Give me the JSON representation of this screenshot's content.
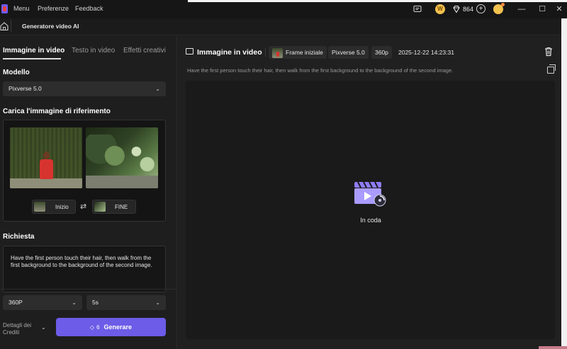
{
  "titlebar": {
    "menu": [
      "Menu",
      "Preferenze",
      "Feedback"
    ],
    "credits": "864",
    "coin_symbol": "W",
    "window_controls": {
      "minimize": "—",
      "maximize": "☐",
      "close": "✕"
    }
  },
  "tab": {
    "title": "Generatore video AI"
  },
  "left": {
    "mode_tabs": [
      "Immagine in video",
      "Testo in video",
      "Effetti creativi"
    ],
    "model_label": "Modello",
    "model_value": "Pixverse 5.0",
    "upload_label": "Carica l'immagine di riferimento",
    "start_label": "Inizio",
    "end_label": "FINE",
    "prompt_label": "Richiesta",
    "prompt_text": "Have the first person touch their hair, then walk from the first background to the background of the second image.",
    "resolution_value": "360P",
    "duration_value": "5s",
    "credits_details": "Dettagli dei Crediti",
    "generate_cost": "6",
    "generate_label": "Generare"
  },
  "right": {
    "title": "Immagine in video",
    "chip_frame": "Frame iniziale",
    "chip_model": "Pixverse 5.0",
    "chip_res": "360p",
    "datetime": "2025-12-22 14:23:31",
    "prompt": "Have the first person touch their hair, then walk from the first background to the background of the second image.",
    "status": "In coda"
  },
  "colors": {
    "accent": "#6c5ce7",
    "background": "#1b1b1b",
    "panel": "#202020"
  }
}
